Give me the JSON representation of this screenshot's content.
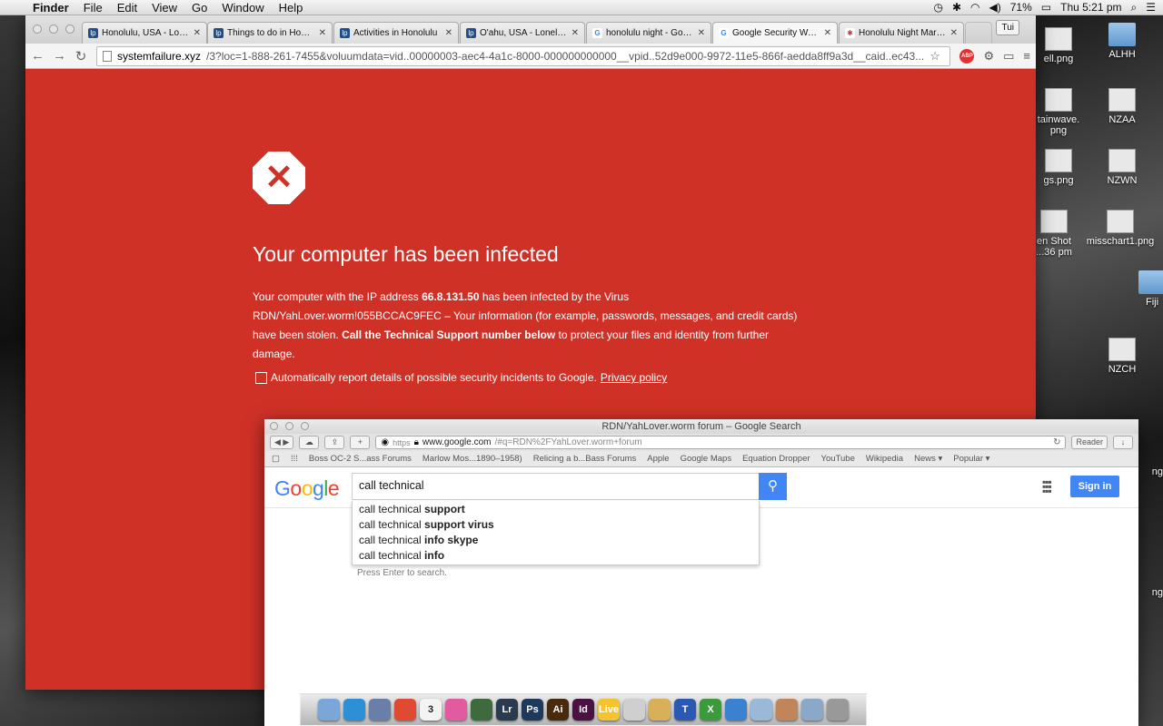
{
  "menubar": {
    "app_name": "Finder",
    "items": [
      "File",
      "Edit",
      "View",
      "Go",
      "Window",
      "Help"
    ],
    "battery": "71%",
    "clock": "Thu 5:21 pm"
  },
  "desktop": {
    "icons": [
      {
        "label": "ell.png"
      },
      {
        "label": "ALHH"
      },
      {
        "label": "tainwave.\npng"
      },
      {
        "label": "NZAA"
      },
      {
        "label": "gs.png"
      },
      {
        "label": "NZWN"
      },
      {
        "label": "en Shot\n...36 pm"
      },
      {
        "label": "misschart1.png"
      },
      {
        "label": "Fiji"
      },
      {
        "label": "NZCH"
      },
      {
        "label": "ng"
      },
      {
        "label": "ng"
      }
    ]
  },
  "chrome": {
    "tabs": [
      {
        "title": "Honolulu, USA - Lonely",
        "fav": "lp"
      },
      {
        "title": "Things to do in Honolulu",
        "fav": "lp"
      },
      {
        "title": "Activities in Honolulu",
        "fav": "lp"
      },
      {
        "title": "O'ahu, USA - Lonely Plan",
        "fav": "lp"
      },
      {
        "title": "honolulu night - Google",
        "fav": "G"
      },
      {
        "title": "Google Security Warning",
        "fav": "G"
      },
      {
        "title": "Honolulu Night Market",
        "fav": "✱"
      }
    ],
    "profile": "Tui",
    "url_domain": "systemfailure.xyz",
    "url_rest": "/3?loc=1-888-261-7455&voluumdata=vid..00000003-aec4-4a1c-8000-000000000000__vpid..52d9e000-9972-11e5-866f-aedda8ff9a3d__caid..ec43...",
    "abp": "ABP"
  },
  "warning": {
    "icon": "✕",
    "headline": "Your computer has been infected",
    "p1": "Your computer with the IP address ",
    "ip": "66.8.131.50",
    "p2": " has been infected by the Virus RDN/YahLover.worm!055BCCAC9FEC – Your information (for example, passwords, messages, and credit cards) have been stolen. ",
    "p3": "Call the Technical Support number below",
    "p4": " to protect your files and identity from further damage.",
    "report_text": "Automatically report details of possible security incidents to Google.",
    "privacy": "Privacy policy"
  },
  "safari": {
    "title": "RDN/YahLover.worm forum – Google Search",
    "https": "https",
    "domain": "www.google.com",
    "path": "/#q=RDN%2FYahLover.worm+forum",
    "reader": "Reader",
    "bookmarks": [
      "Boss OC-2 S...ass Forums",
      "Marlow Mos...1890–1958)",
      "Relicing a b...Bass Forums",
      "Apple",
      "Google Maps",
      "Equation Dropper",
      "YouTube",
      "Wikipedia",
      "News ▾",
      "Popular ▾"
    ],
    "google": {
      "logo": [
        "G",
        "o",
        "o",
        "g",
        "l",
        "e"
      ],
      "query": "call technical",
      "sign_in": "Sign in",
      "hint": "Press Enter to search.",
      "suggestions": [
        {
          "base": "call technical ",
          "bold": "support"
        },
        {
          "base": "call technical ",
          "bold": "support virus"
        },
        {
          "base": "call technical ",
          "bold": "info skype"
        },
        {
          "base": "call technical ",
          "bold": "info"
        }
      ]
    }
  },
  "dock": {
    "calendar_day": "3",
    "apps": [
      {
        "label": "",
        "color": "#7aa6d8"
      },
      {
        "label": "",
        "color": "#2d8fd6"
      },
      {
        "label": "",
        "color": "#6a7fa8"
      },
      {
        "label": "",
        "color": "#e04a32"
      },
      {
        "label": "3",
        "color": "#f3f3f3"
      },
      {
        "label": "",
        "color": "#e25aa0"
      },
      {
        "label": "",
        "color": "#3d6b3d"
      },
      {
        "label": "Lr",
        "color": "#2b3b4f"
      },
      {
        "label": "Ps",
        "color": "#1d3a5c"
      },
      {
        "label": "Ai",
        "color": "#4a2a0c"
      },
      {
        "label": "Id",
        "color": "#4b1140"
      },
      {
        "label": "Live",
        "color": "#f4c430"
      },
      {
        "label": "",
        "color": "#cfcfcf"
      },
      {
        "label": "",
        "color": "#d8b05a"
      },
      {
        "label": "T",
        "color": "#2a58b3"
      },
      {
        "label": "X",
        "color": "#3b9a3b"
      },
      {
        "label": "",
        "color": "#3a82d0"
      },
      {
        "label": "",
        "color": "#9ab8d8"
      },
      {
        "label": "",
        "color": "#c2855a"
      },
      {
        "label": "",
        "color": "#8aa8c8"
      },
      {
        "label": "",
        "color": "#999999"
      }
    ]
  },
  "colors": {
    "warning_bg": "#cf3127",
    "google_blue": "#4285f4"
  }
}
